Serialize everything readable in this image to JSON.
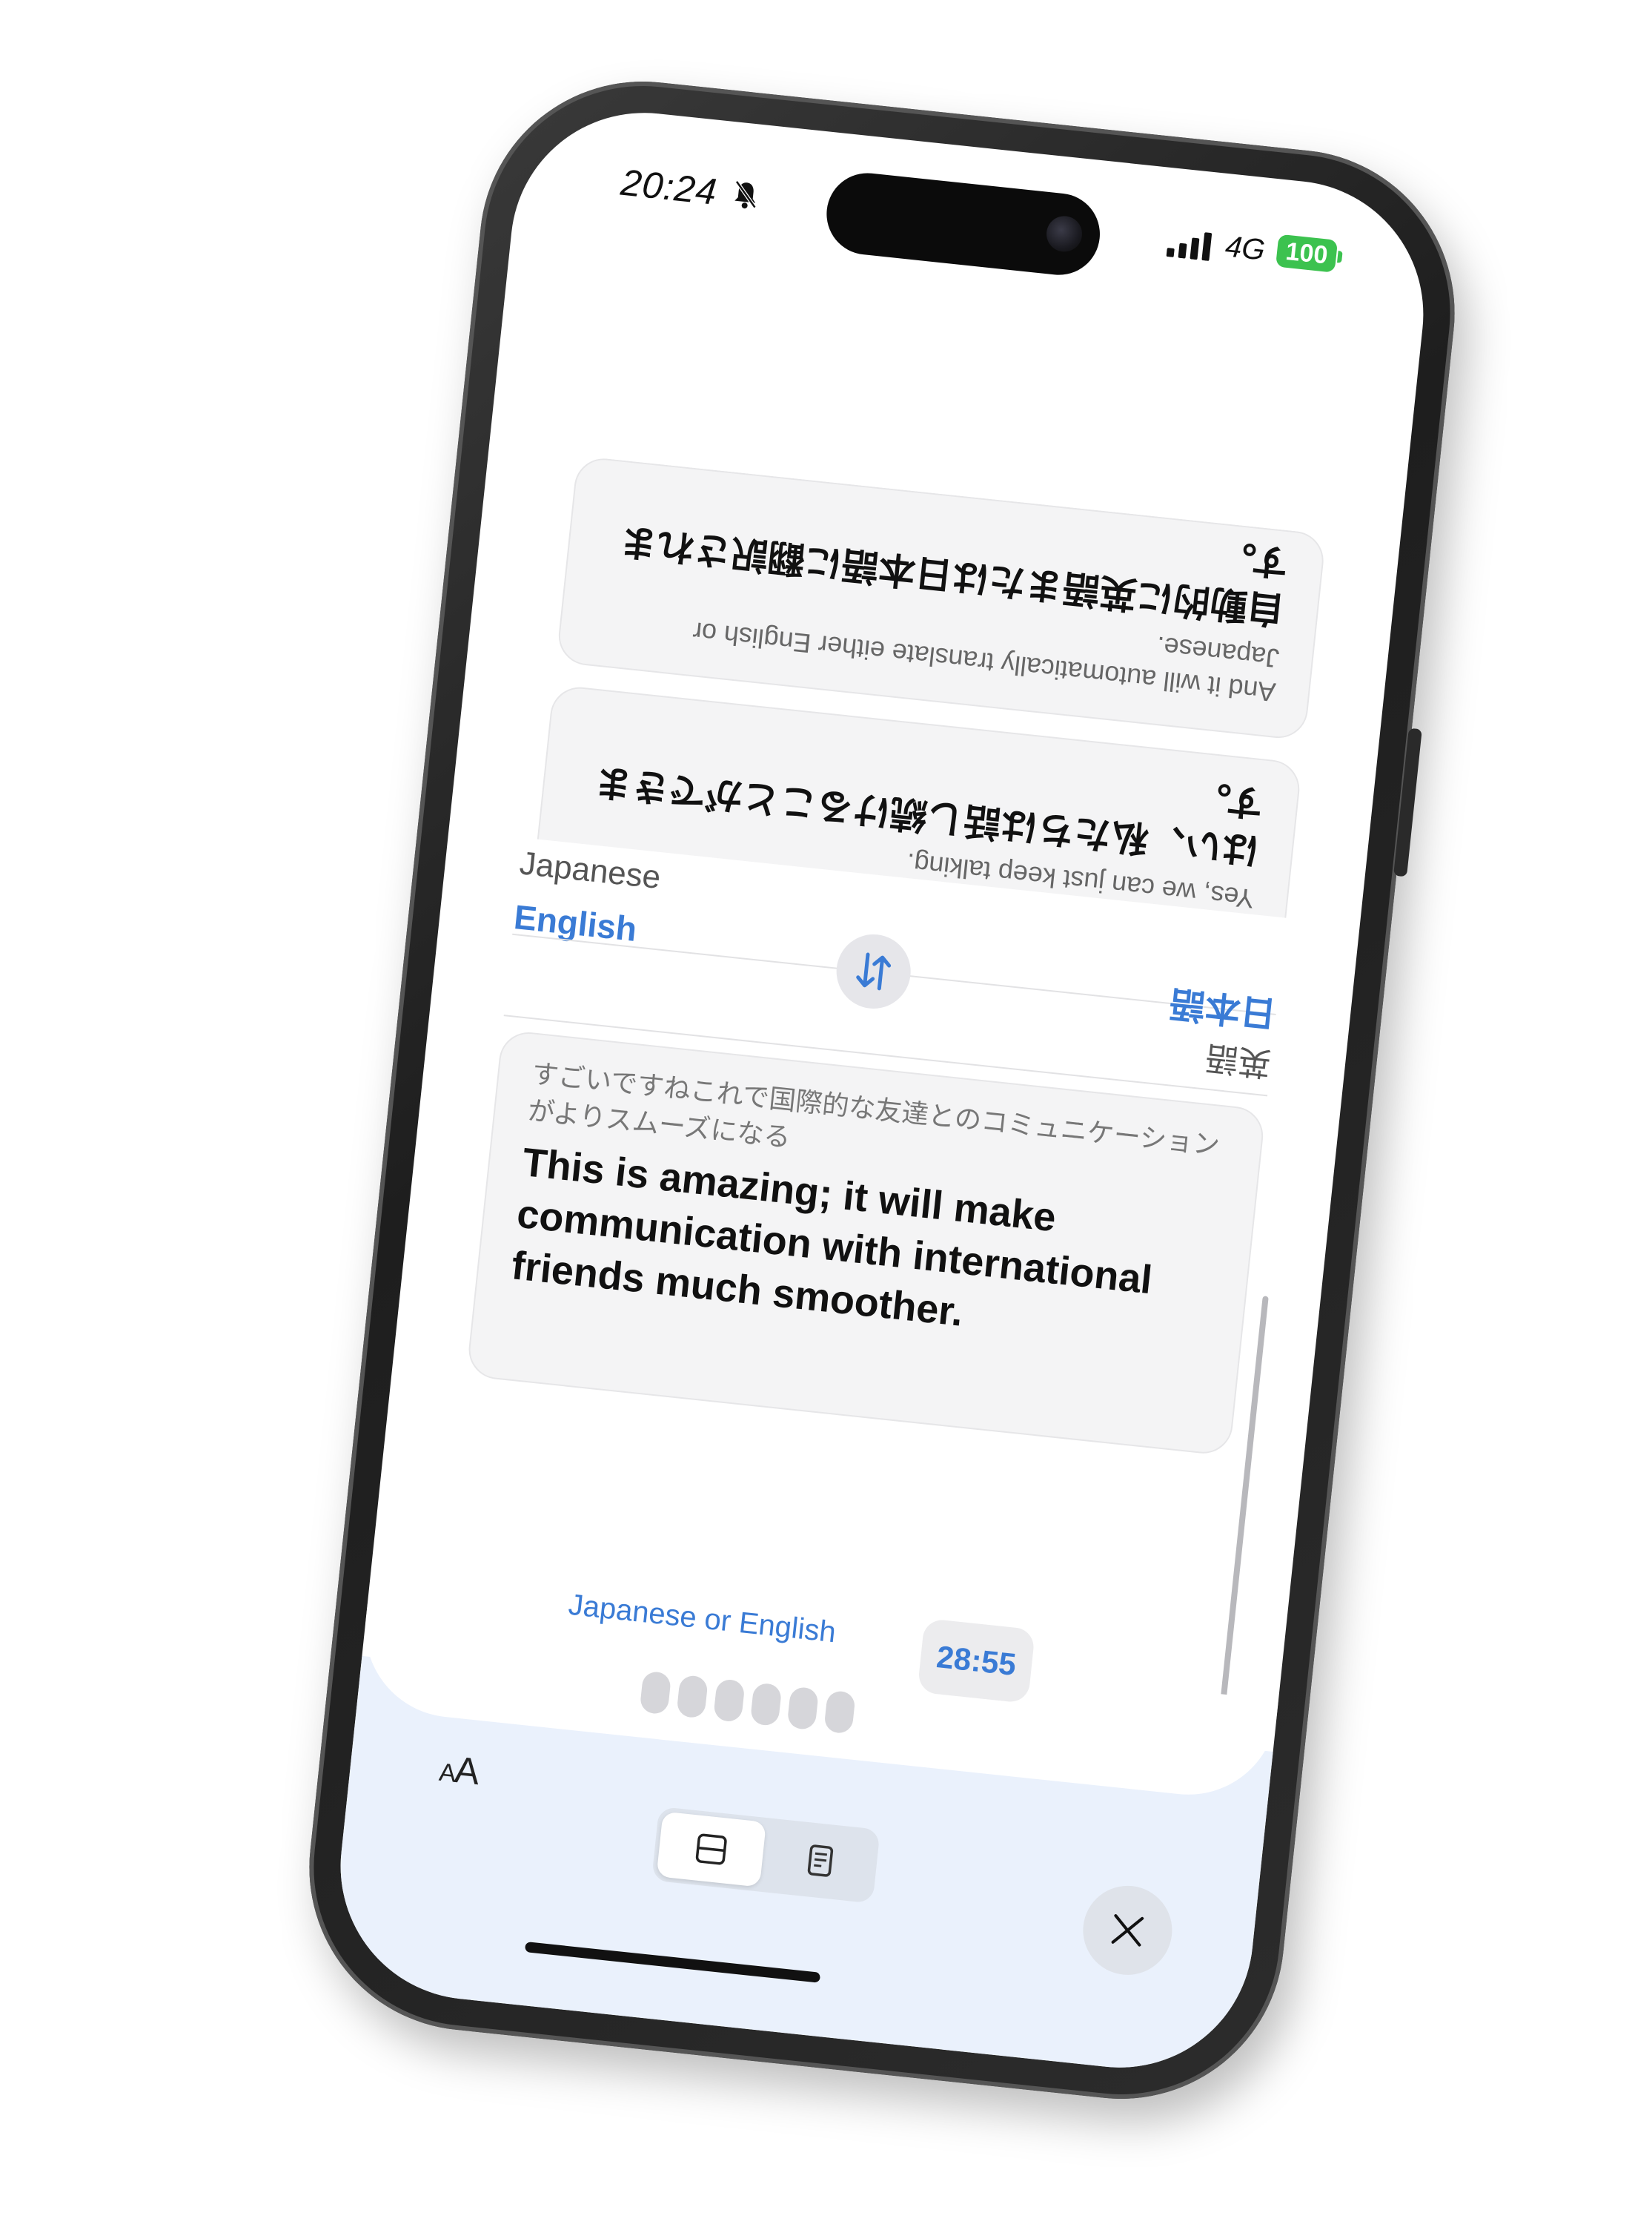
{
  "status_bar": {
    "time": "20:24",
    "network": "4G",
    "battery": "100"
  },
  "conversation": [
    {
      "original": "And it will automatically translate either English or Japanese.",
      "translation": "自動的に英語または日本語に翻訳されます。"
    },
    {
      "original": "Yes, we can just keep talking.",
      "translation": "はい、私たちは話し続けることができます。"
    }
  ],
  "language_switcher": {
    "left_top": "Japanese",
    "left_bottom": "English",
    "right_top": "日本語",
    "right_bottom": "英語"
  },
  "current": {
    "original": "すごいですねこれで国際的な友達とのコミュニケーションがよりスムーズになる",
    "translation": "This is amazing; it will make communication with international friends much smoother."
  },
  "listening": {
    "hint": "Japanese or English",
    "timer": "28:55"
  },
  "toolbar": {
    "font_size_label_small": "A",
    "font_size_label_large": "A"
  },
  "colors": {
    "accent": "#3a7bd5",
    "battery": "#3cc24f",
    "bottom_bg": "#eaf1fc"
  }
}
